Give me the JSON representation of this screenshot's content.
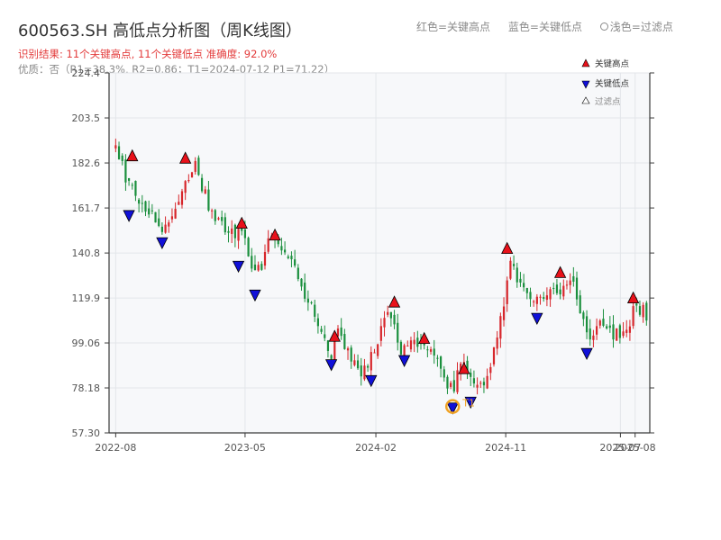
{
  "title": "600563.SH 高低点分析图（周K线图）",
  "subtitle_result": "识别结果: 11个关键高点, 11个关键低点   准确度: 92.0%",
  "subtitle_quality": "优质：否（R1=38.3%, R2=0.86；T1=2024-07-12 P1=71.22）",
  "legend_top": {
    "red": "红色=关键高点",
    "blue": "蓝色=关键低点",
    "hollow": "浅色=过滤点"
  },
  "legend_chart": {
    "high": "关键高点",
    "low": "关键低点",
    "filtered": "过滤点"
  },
  "colors": {
    "up": "#d7262b",
    "down": "#1a8f3d",
    "high_marker": "#e8111a",
    "low_marker": "#1010d8",
    "t1_ring": "#f0a224",
    "axis": "#3a3a3a",
    "plot_bg": "#f7f8fa",
    "grid": "#e3e6ea"
  },
  "chart_data": {
    "type": "candlestick",
    "frequency": "weekly",
    "x_tick_labels": [
      "2022-08",
      "2023-05",
      "2024-02",
      "2024-11",
      "2025-07",
      "2025-08"
    ],
    "y_ticks": [
      "57.30",
      "78.18",
      "99.06",
      "119.9",
      "140.8",
      "161.7",
      "182.6",
      "203.5",
      "224.4"
    ],
    "ylim": [
      57.3,
      224.4
    ],
    "close_path": [
      [
        "2022-08-01",
        188
      ],
      [
        "2022-08-22",
        177
      ],
      [
        "2022-09-12",
        168
      ],
      [
        "2022-10-10",
        160
      ],
      [
        "2022-11-07",
        148
      ],
      [
        "2022-11-28",
        160
      ],
      [
        "2022-12-19",
        170
      ],
      [
        "2023-01-16",
        182
      ],
      [
        "2023-02-13",
        162
      ],
      [
        "2023-03-13",
        155
      ],
      [
        "2023-04-10",
        150
      ],
      [
        "2023-04-24",
        153
      ],
      [
        "2023-05-15",
        136
      ],
      [
        "2023-06-05",
        130
      ],
      [
        "2023-06-19",
        148
      ],
      [
        "2023-07-17",
        140
      ],
      [
        "2023-08-14",
        136
      ],
      [
        "2023-09-11",
        118
      ],
      [
        "2023-10-09",
        104
      ],
      [
        "2023-10-30",
        95
      ],
      [
        "2023-11-13",
        103
      ],
      [
        "2023-12-04",
        95
      ],
      [
        "2024-01-01",
        86
      ],
      [
        "2024-01-22",
        92
      ],
      [
        "2024-02-19",
        110
      ],
      [
        "2024-03-04",
        114
      ],
      [
        "2024-03-25",
        95
      ],
      [
        "2024-04-15",
        98
      ],
      [
        "2024-05-06",
        100
      ],
      [
        "2024-05-27",
        93
      ],
      [
        "2024-06-17",
        86
      ],
      [
        "2024-07-12",
        76
      ],
      [
        "2024-07-29",
        90
      ],
      [
        "2024-08-19",
        82
      ],
      [
        "2024-09-09",
        80
      ],
      [
        "2024-09-30",
        86
      ],
      [
        "2024-10-14",
        102
      ],
      [
        "2024-10-28",
        118
      ],
      [
        "2024-11-11",
        138
      ],
      [
        "2024-12-02",
        126
      ],
      [
        "2024-12-30",
        118
      ],
      [
        "2025-01-20",
        120
      ],
      [
        "2025-02-17",
        124
      ],
      [
        "2025-03-17",
        128
      ],
      [
        "2025-04-07",
        116
      ],
      [
        "2025-04-28",
        102
      ],
      [
        "2025-05-19",
        106
      ],
      [
        "2025-06-16",
        104
      ],
      [
        "2025-07-14",
        105
      ],
      [
        "2025-08-04",
        117
      ],
      [
        "2025-08-25",
        112
      ]
    ],
    "key_highs": [
      {
        "date": "2022-09-05",
        "price": 183.6
      },
      {
        "date": "2022-12-26",
        "price": 182.5
      },
      {
        "date": "2023-04-24",
        "price": 152.3
      },
      {
        "date": "2023-07-03",
        "price": 146.8
      },
      {
        "date": "2023-11-06",
        "price": 99.8
      },
      {
        "date": "2024-03-11",
        "price": 115.7
      },
      {
        "date": "2024-05-13",
        "price": 98.8
      },
      {
        "date": "2024-08-05",
        "price": 84.8
      },
      {
        "date": "2024-11-04",
        "price": 140.6
      },
      {
        "date": "2025-02-24",
        "price": 129.4
      },
      {
        "date": "2025-07-28",
        "price": 117.6
      }
    ],
    "key_lows": [
      {
        "date": "2022-08-29",
        "price": 160.5
      },
      {
        "date": "2022-11-07",
        "price": 147.9
      },
      {
        "date": "2023-04-17",
        "price": 137.0
      },
      {
        "date": "2023-05-22",
        "price": 123.6
      },
      {
        "date": "2023-10-30",
        "price": 91.3
      },
      {
        "date": "2024-01-22",
        "price": 83.9
      },
      {
        "date": "2024-04-01",
        "price": 93.2
      },
      {
        "date": "2024-07-12",
        "price": 71.2
      },
      {
        "date": "2024-08-19",
        "price": 73.9
      },
      {
        "date": "2025-01-06",
        "price": 112.8
      },
      {
        "date": "2025-04-21",
        "price": 96.5
      }
    ],
    "t1": {
      "label": "T1",
      "date": "2024-07-12",
      "price": 71.22
    }
  }
}
